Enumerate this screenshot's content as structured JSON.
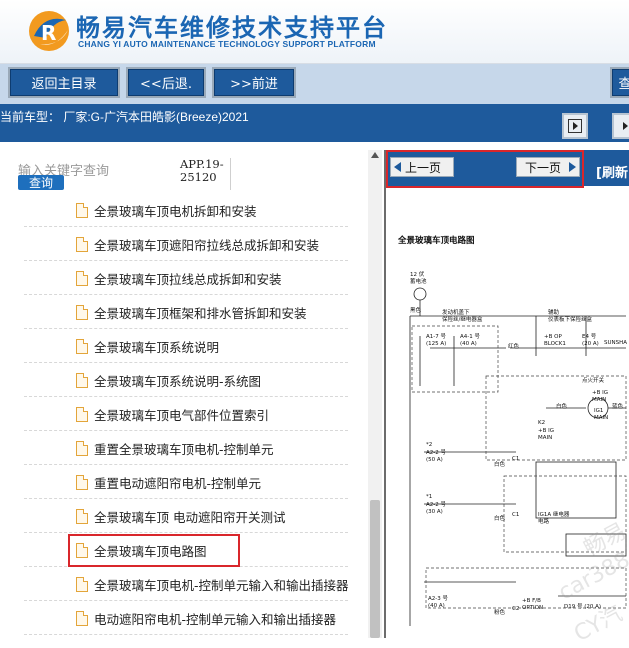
{
  "header": {
    "title": "畅易汽车维修技术支持平台",
    "subtitle": "CHANG YI AUTO MAINTENANCE TECHNOLOGY SUPPORT PLATFORM",
    "logo_icon": "cy-logo-icon"
  },
  "toolbar": {
    "back_label": "返回主目录",
    "prev_label": "<<后退.",
    "next_label": ">>前进",
    "cut_label": "查"
  },
  "vehicle_bar": {
    "text": "当前车型：  厂家:G-广汽本田皓影(Breeze)2021"
  },
  "search": {
    "placeholder": "输入关键字查询",
    "button_label": "查询",
    "app_code_line1": "APP.19-",
    "app_code_line2": "25120"
  },
  "tree": {
    "items": [
      {
        "label": "全景玻璃车顶电机拆卸和安装"
      },
      {
        "label": "全景玻璃车顶遮阳帘拉线总成拆卸和安装"
      },
      {
        "label": "全景玻璃车顶拉线总成拆卸和安装"
      },
      {
        "label": "全景玻璃车顶框架和排水管拆卸和安装"
      },
      {
        "label": "全景玻璃车顶系统说明"
      },
      {
        "label": "全景玻璃车顶系统说明-系统图"
      },
      {
        "label": "全景玻璃车顶电气部件位置索引"
      },
      {
        "label": "重置全景玻璃车顶电机-控制单元"
      },
      {
        "label": "重置电动遮阳帘电机-控制单元"
      },
      {
        "label": "全景玻璃车顶 电动遮阳帘开关测试"
      },
      {
        "label": "全景玻璃车顶电路图"
      },
      {
        "label": "全景玻璃车顶电机-控制单元输入和输出插接器"
      },
      {
        "label": "电动遮阳帘电机-控制单元输入和输出插接器"
      }
    ],
    "selected_index": 10
  },
  "pager": {
    "prev_label": "上一页",
    "next_label": "下一页",
    "refresh_label": "[刷新"
  },
  "diagram": {
    "title": "全景玻璃车顶电路图",
    "labels": {
      "battery": "12 伏\n蓄电池",
      "black": "黑色",
      "under_hood": "发动机盖下\n保险丝/继电器盒",
      "aux": "辅助\n仪表板下保险丝盒",
      "a1_7": "A1-7 号\n(125 A)",
      "a4_1": "A4-1 号\n(40 A)",
      "red": "红色",
      "op_block": "+B OP\nBLOCK1",
      "e4": "E4 号\n(20 A)",
      "sunshade": "SUNSHA",
      "ign_switch": "点火开关",
      "ig_main": "+B IG\nMAIN",
      "white": "白色",
      "blue": "蓝色",
      "ig1": "IG1\nMAIN",
      "k2": "K2",
      "c1": "C1",
      "a2_2": "A2-2 号\n(50 A)",
      "a2_2b": "A2-2 号\n(30 A)",
      "ig_main2": "+B IG\nMAIN",
      "ig1a": "IG1A 继电器\n电路",
      "a2_3": "A2-3 号\n(40 A)",
      "pink": "粉色",
      "c2": "C2",
      "option": "+B F/B\nOPTION",
      "d19": "D19 号 (20 A)",
      "star2": "*2",
      "star1": "*1"
    }
  },
  "watermarks": [
    "畅易",
    "car388",
    "CY汽"
  ],
  "colors": {
    "brand_blue": "#1e5a9c",
    "highlight_red": "#d9262b",
    "doc_icon_orange": "#e3a53a"
  }
}
